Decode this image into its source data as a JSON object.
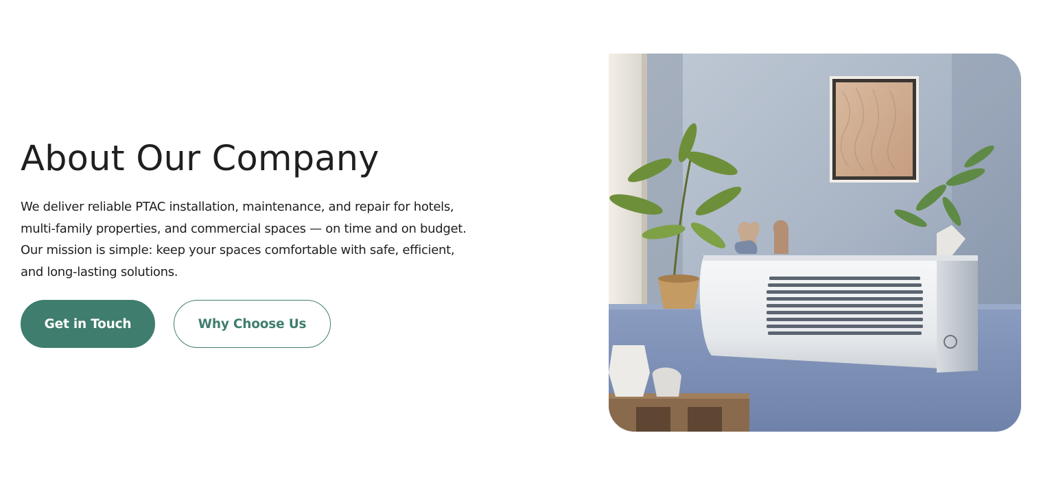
{
  "about": {
    "title": "About Our Company",
    "description_lines": [
      "We deliver reliable PTAC installation, maintenance, and repair for hotels,",
      "multi-family properties, and commercial spaces — on time and on budget.",
      "Our mission is simple: keep your spaces comfortable with safe, efficient,",
      "and long-lasting solutions."
    ],
    "primary_button": "Get in Touch",
    "secondary_button": "Why Choose Us"
  },
  "image": {
    "subject": "ptac-unit-photo",
    "colors": {
      "wall": "#a9b5c6",
      "ledge": "#7f92b6",
      "unit": "#eef0f1"
    }
  },
  "colors": {
    "accent": "#3f7d6e",
    "text": "#1e1e1e",
    "background": "#ffffff"
  }
}
